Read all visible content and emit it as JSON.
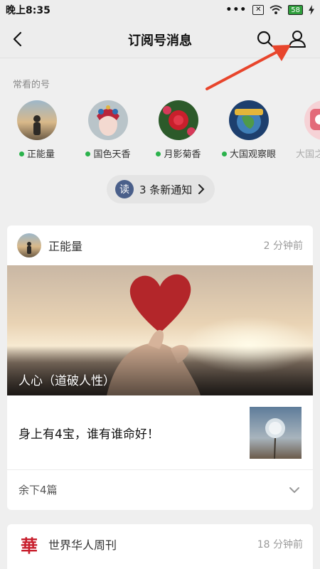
{
  "status_bar": {
    "time": "晚上8:35",
    "signal_dots": "•••",
    "sim_label": "✕",
    "battery": "58"
  },
  "nav": {
    "title": "订阅号消息"
  },
  "frequent": {
    "label": "常看的号",
    "accounts": [
      {
        "name": "正能量"
      },
      {
        "name": "国色天香"
      },
      {
        "name": "月影菊香"
      },
      {
        "name": "大国观察眼"
      },
      {
        "name": "大国之"
      }
    ]
  },
  "notify": {
    "icon_char": "读",
    "text": "3 条新通知"
  },
  "card1": {
    "source": "正能量",
    "time": "2 分钟前",
    "hero_caption": "人心（道破人性）",
    "sub_title": "身上有4宝，谁有谁命好！",
    "more": "余下4篇"
  },
  "card2": {
    "logo_char": "華",
    "source": "世界华人周刊",
    "time": "18 分钟前"
  },
  "colors": {
    "green_dot": "#2bb24c",
    "arrow_red": "#e8452c",
    "background": "#efefef"
  }
}
